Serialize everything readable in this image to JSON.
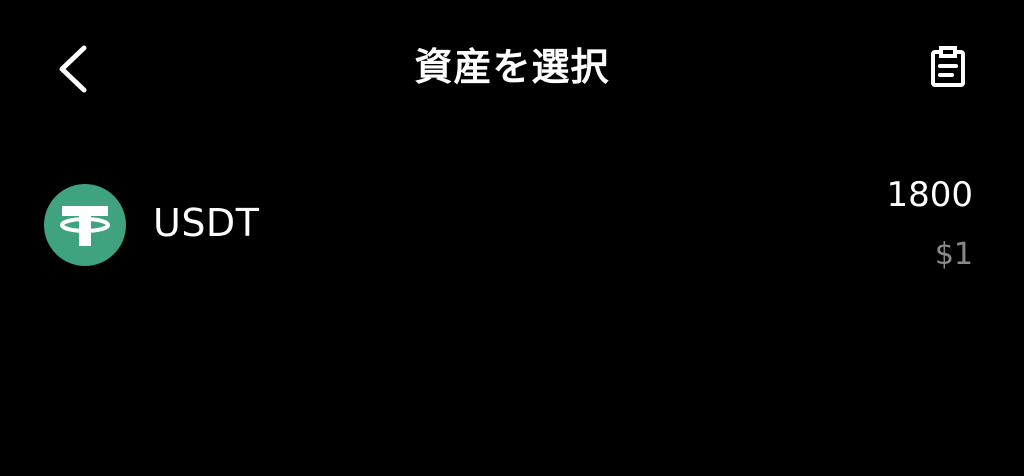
{
  "header": {
    "title": "資産を選択",
    "back_icon": "chevron-left-icon",
    "history_icon": "document-list-icon"
  },
  "assets": [
    {
      "symbol": "USDT",
      "amount": "1800",
      "fiat_value": "$1",
      "icon": "tether-icon",
      "icon_color": "#3fa37f"
    }
  ],
  "colors": {
    "background": "#000000",
    "text_primary": "#ffffff",
    "text_secondary": "#8a8a8a"
  }
}
